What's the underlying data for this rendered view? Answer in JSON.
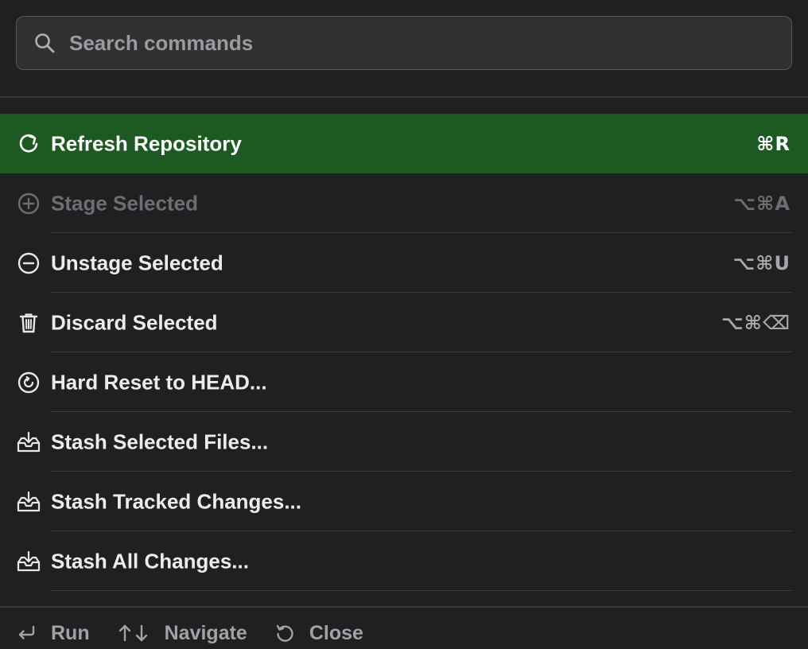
{
  "search": {
    "placeholder": "Search commands",
    "value": ""
  },
  "commands": [
    {
      "label": "Refresh Repository",
      "shortcut": "⌘R",
      "icon": "refresh-icon",
      "state": "selected"
    },
    {
      "label": "Stage Selected",
      "shortcut": "⌥⌘A",
      "icon": "plus-circle-icon",
      "state": "disabled"
    },
    {
      "label": "Unstage Selected",
      "shortcut": "⌥⌘U",
      "icon": "minus-circle-icon",
      "state": "enabled"
    },
    {
      "label": "Discard Selected",
      "shortcut": "⌥⌘⌫",
      "icon": "trash-icon",
      "state": "enabled"
    },
    {
      "label": "Hard Reset to HEAD...",
      "shortcut": "",
      "icon": "reset-clock-icon",
      "state": "enabled"
    },
    {
      "label": "Stash Selected Files...",
      "shortcut": "",
      "icon": "tray-download-icon",
      "state": "enabled"
    },
    {
      "label": "Stash Tracked Changes...",
      "shortcut": "",
      "icon": "tray-download-icon",
      "state": "enabled"
    },
    {
      "label": "Stash All Changes...",
      "shortcut": "",
      "icon": "tray-download-icon",
      "state": "enabled"
    }
  ],
  "footer": {
    "run": {
      "icon": "return-icon",
      "label": "Run"
    },
    "navigate": {
      "icon": "up-down-arrows-icon",
      "label": "Navigate"
    },
    "close": {
      "icon": "escape-icon",
      "label": "Close"
    }
  },
  "colors": {
    "background": "#202022",
    "selected": "#1d5a22",
    "search_field": "#303033"
  }
}
